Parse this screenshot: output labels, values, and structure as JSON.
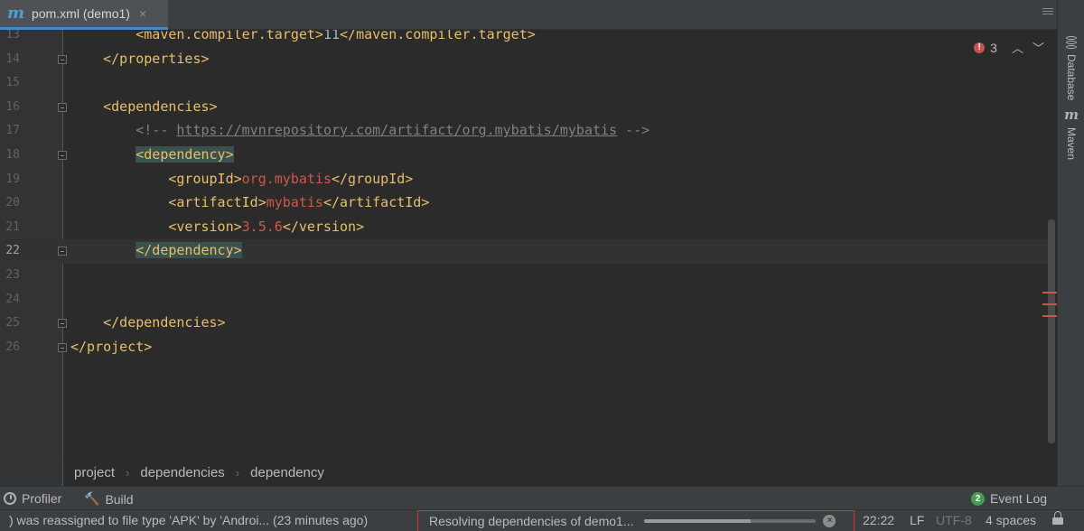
{
  "tab": {
    "icon": "maven-m-icon",
    "icon_text": "m",
    "label": "pom.xml (demo1)",
    "close": "×"
  },
  "editor": {
    "errors": {
      "count": "3",
      "icon_text": "!",
      "up": "︿",
      "down": "﹀"
    },
    "lines": [
      {
        "num": "13",
        "indent": "        ",
        "parts": [
          [
            "tag",
            "<maven.compiler.target>"
          ],
          [
            "plain",
            "11"
          ],
          [
            "tag",
            "</maven.compiler.target>"
          ]
        ]
      },
      {
        "num": "14",
        "indent": "    ",
        "parts": [
          [
            "tag",
            "</properties>"
          ]
        ]
      },
      {
        "num": "15",
        "indent": "",
        "parts": []
      },
      {
        "num": "16",
        "indent": "    ",
        "parts": [
          [
            "tag",
            "<dependencies>"
          ]
        ]
      },
      {
        "num": "17",
        "indent": "        ",
        "parts": [
          [
            "cmt",
            "<!-- "
          ],
          [
            "url",
            "https://mvnrepository.com/artifact/org.mybatis/mybatis"
          ],
          [
            "cmt",
            " -->"
          ]
        ]
      },
      {
        "num": "18",
        "indent": "        ",
        "parts": [
          [
            "tag hl",
            "<dependency>"
          ]
        ]
      },
      {
        "num": "19",
        "indent": "            ",
        "parts": [
          [
            "tag",
            "<groupId>"
          ],
          [
            "val",
            "org.mybatis"
          ],
          [
            "tag",
            "</groupId>"
          ]
        ]
      },
      {
        "num": "20",
        "indent": "            ",
        "parts": [
          [
            "tag",
            "<artifactId>"
          ],
          [
            "val",
            "mybatis"
          ],
          [
            "tag",
            "</artifactId>"
          ]
        ]
      },
      {
        "num": "21",
        "indent": "            ",
        "parts": [
          [
            "tag",
            "<version>"
          ],
          [
            "val",
            "3.5.6"
          ],
          [
            "tag",
            "</version>"
          ]
        ]
      },
      {
        "num": "22",
        "indent": "        ",
        "parts": [
          [
            "tag hl",
            "</dependency>"
          ]
        ]
      },
      {
        "num": "23",
        "indent": "",
        "parts": []
      },
      {
        "num": "24",
        "indent": "",
        "parts": []
      },
      {
        "num": "25",
        "indent": "    ",
        "parts": [
          [
            "tag",
            "</dependencies>"
          ]
        ]
      },
      {
        "num": "26",
        "indent": "",
        "parts": [
          [
            "tag",
            "</project>"
          ]
        ]
      }
    ]
  },
  "breadcrumb": [
    "project",
    "dependencies",
    "dependency"
  ],
  "breadcrumb_sep": "›",
  "right_sidebar": [
    {
      "label": "Database",
      "icon": "database-icon"
    },
    {
      "label": "Maven",
      "icon": "maven-icon",
      "icon_text": "m"
    }
  ],
  "tool_windows": {
    "profiler": {
      "label": "Profiler",
      "icon": "gauge-icon"
    },
    "build": {
      "label": "Build",
      "icon": "hammer-icon",
      "icon_text": "🔨"
    },
    "event_log": {
      "label": "Event Log",
      "badge": "2"
    }
  },
  "status": {
    "message": ") was reassigned to file type 'APK' by 'Androi... (23 minutes ago)",
    "progress_label": "Resolving dependencies of demo1...",
    "progress_fraction": 0.62,
    "cancel_text": "×",
    "position": "22:22",
    "line_sep": "LF",
    "encoding": "UTF-8",
    "indent": "4 spaces"
  }
}
